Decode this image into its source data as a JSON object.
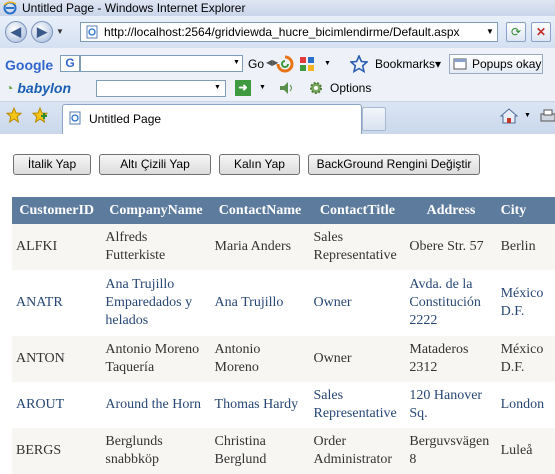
{
  "window": {
    "title": "Untitled Page - Windows Internet Explorer"
  },
  "address": {
    "url": "http://localhost:2564/gridviewda_hucre_bicimlendirme/Default.aspx"
  },
  "google": {
    "logo": "Google",
    "go": "Go",
    "bookmarks": "Bookmarks",
    "popups": "Popups okay"
  },
  "babylon": {
    "logo": "babylon",
    "options": "Options"
  },
  "tab": {
    "title": "Untitled Page"
  },
  "buttons": {
    "italic": "İtalik Yap",
    "underline": "Altı Çizili Yap",
    "bold": "Kalın Yap",
    "background": "BackGround Rengini Değiştir"
  },
  "grid": {
    "headers": [
      "CustomerID",
      "CompanyName",
      "ContactName",
      "ContactTitle",
      "Address",
      "City"
    ],
    "rows": [
      [
        "ALFKI",
        "Alfreds Futterkiste",
        "Maria Anders",
        "Sales Representative",
        "Obere Str. 57",
        "Berlin"
      ],
      [
        "ANATR",
        "Ana Trujillo Emparedados y helados",
        "Ana Trujillo",
        "Owner",
        "Avda. de la Constitución 2222",
        "México D.F."
      ],
      [
        "ANTON",
        "Antonio Moreno Taquería",
        "Antonio Moreno",
        "Owner",
        "Mataderos 2312",
        "México D.F."
      ],
      [
        "AROUT",
        "Around the Horn",
        "Thomas Hardy",
        "Sales Representative",
        "120 Hanover Sq.",
        "London"
      ],
      [
        "BERGS",
        "Berglunds snabbköp",
        "Christina Berglund",
        "Order Administrator",
        "Berguvsvägen 8",
        "Luleå"
      ]
    ]
  },
  "colors": {
    "header_bg": "#5d7b9d",
    "odd_row_bg": "#f7f6f3",
    "odd_text": "#333333",
    "even_text": "#284775"
  }
}
